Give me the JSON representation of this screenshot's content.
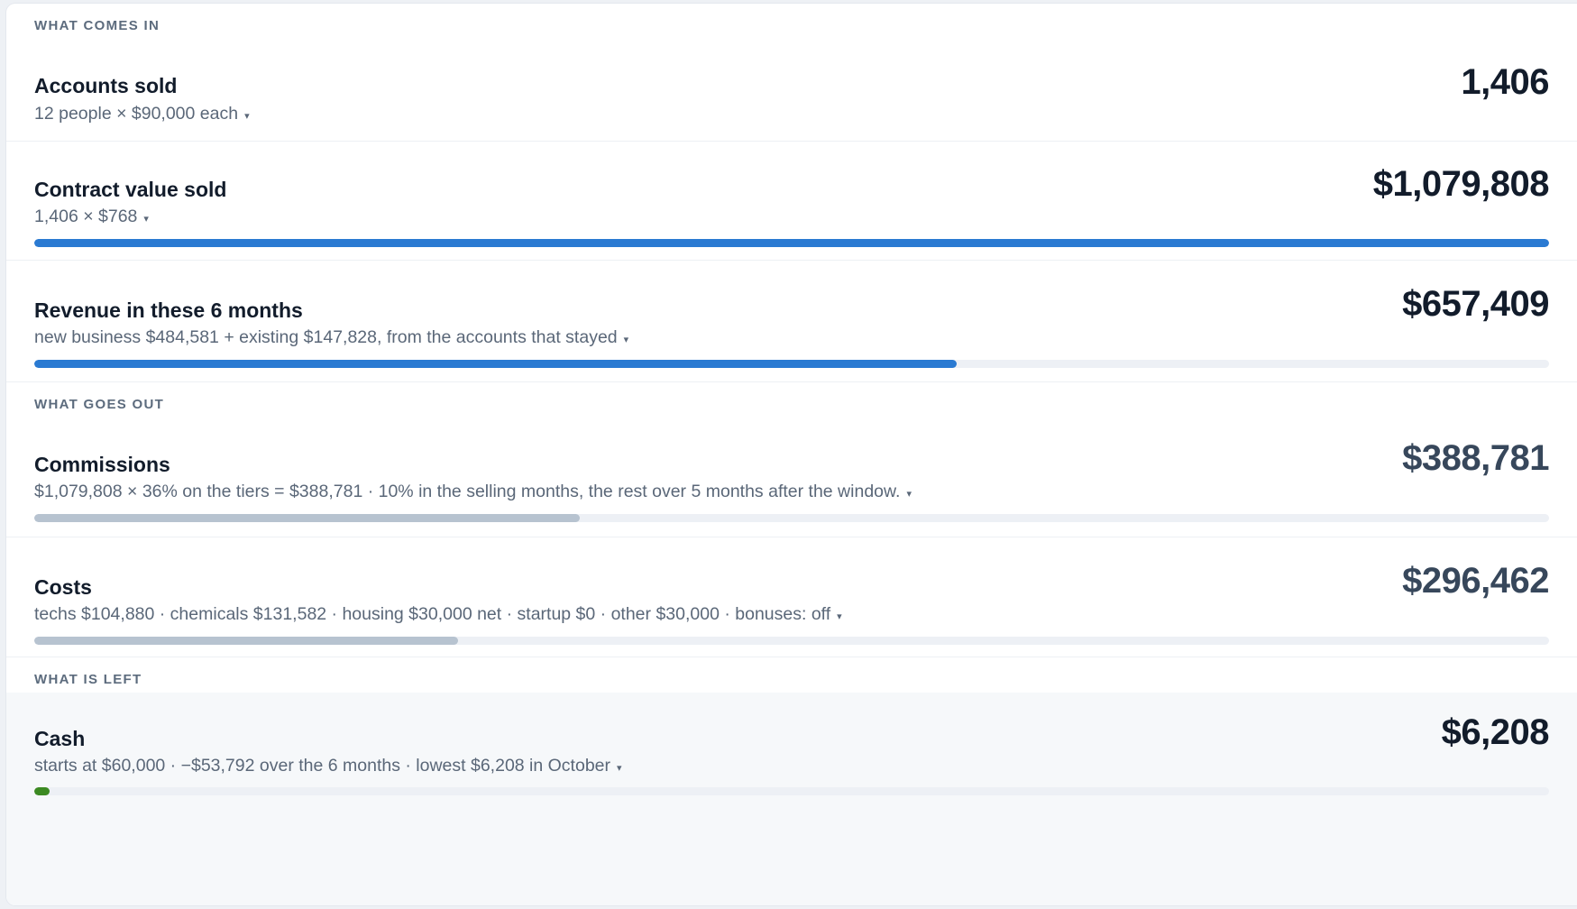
{
  "sections": {
    "comes_in": "WHAT COMES IN",
    "goes_out": "WHAT GOES OUT",
    "is_left": "WHAT IS LEFT"
  },
  "rows": [
    {
      "label": "Accounts sold",
      "detail": "12 people × $90,000 each",
      "value": "1,406",
      "has_bar": false
    },
    {
      "label": "Contract value sold",
      "detail": "1,406 × $768",
      "value": "$1,079,808",
      "has_bar": true,
      "bar_fraction": 1.0,
      "bar_color": "#2a7ad2"
    },
    {
      "label": "Revenue in these 6 months",
      "detail": "new business $484,581 + existing $147,828, from the accounts that stayed",
      "value": "$657,409",
      "has_bar": true,
      "bar_fraction": 0.609,
      "bar_color": "#2a7ad2"
    },
    {
      "label": "Commissions",
      "detail": "$1,079,808 × 36% on the tiers = $388,781 · 10% in the selling months, the rest over 5 months after the window.",
      "value": "$388,781",
      "has_bar": true,
      "bar_fraction": 0.36,
      "bar_color": "#b7c3d0"
    },
    {
      "label": "Costs",
      "detail": "techs $104,880 · chemicals $131,582 · housing $30,000 net · startup $0 · other $30,000 · bonuses: off",
      "value": "$296,462",
      "has_bar": true,
      "bar_fraction": 0.28,
      "bar_color": "#b7c3d0"
    },
    {
      "label": "Cash",
      "detail": "starts at $60,000 · −$53,792 over the 6 months · lowest $6,208 in October",
      "value": "$6,208",
      "has_bar": true,
      "bar_fraction": 0.0103,
      "bar_color": "#3c8a22"
    }
  ],
  "caret_glyph": "▾",
  "icons": {
    "expand": "chevron-down-icon"
  }
}
